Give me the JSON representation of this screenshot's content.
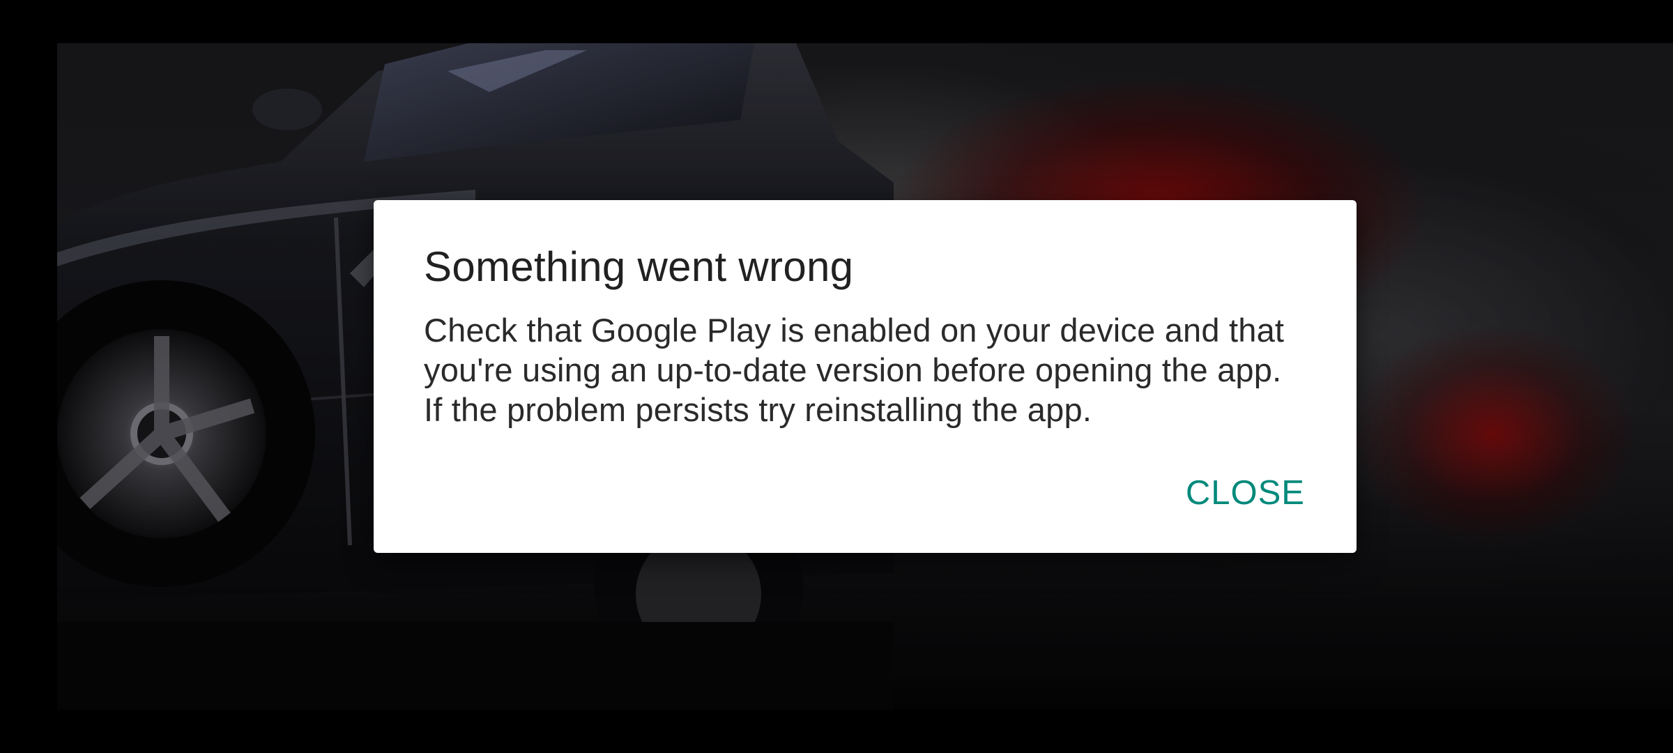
{
  "dialog": {
    "title": "Something went wrong",
    "message": "Check that Google Play is enabled on your device and that you're using an up-to-date version before opening the app. If the problem persists try reinstalling the app.",
    "close_label": "CLOSE"
  },
  "colors": {
    "accent": "#00897b",
    "dialog_background": "#ffffff",
    "title_text": "#212121",
    "scrim": "#000000"
  },
  "background": {
    "description_icon": "sports-car-drift-artwork"
  }
}
